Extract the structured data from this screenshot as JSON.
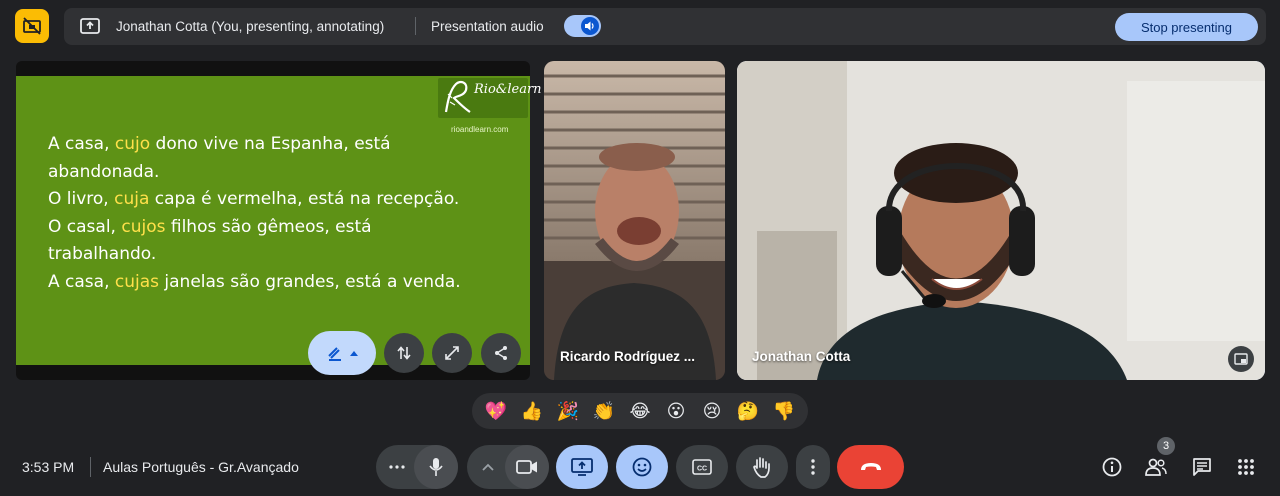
{
  "top_bar": {
    "presenter_label": "Jonathan Cotta (You, presenting, annotating)",
    "audio_label": "Presentation audio",
    "audio_on": true,
    "stop_button": "Stop presenting"
  },
  "slide": {
    "logo_name": "Rio&learn",
    "logo_url": "rioandlearn.com",
    "sentences": [
      {
        "before": "A casa, ",
        "highlight": "cujo",
        "after": " dono vive na Espanha, está abandonada."
      },
      {
        "before": "O livro, ",
        "highlight": "cuja",
        "after": " capa é vermelha, está na recepção."
      },
      {
        "before": "O casal, ",
        "highlight": "cujos",
        "after": " filhos são gêmeos, está trabalhando."
      },
      {
        "before": "A casa, ",
        "highlight": "cujas",
        "after": " janelas são grandes, está a venda."
      }
    ],
    "highlight_color": "#ffe04a",
    "background_color": "#5e9216"
  },
  "participants": [
    {
      "name": "Ricardo Rodríguez ..."
    },
    {
      "name": "Jonathan Cotta"
    }
  ],
  "reactions": [
    "💖",
    "👍",
    "🎉",
    "👏",
    "😂",
    "😮",
    "😢",
    "🤔",
    "👎"
  ],
  "bottom_bar": {
    "time": "3:53 PM",
    "meeting_name": "Aulas Português - Gr.Avançado",
    "participant_count": "3"
  },
  "colors": {
    "accent": "#a8c7fa",
    "end_call": "#ea4335",
    "hide_button": "#fbbc04"
  },
  "icons": [
    "hide-self-icon",
    "present-icon",
    "volume-icon",
    "pen-icon",
    "caret-up-icon",
    "swap-icon",
    "fullscreen-icon",
    "share-icon",
    "pip-icon",
    "more-icon",
    "mic-icon",
    "chevron-up-icon",
    "camera-icon",
    "present-screen-icon",
    "emoji-icon",
    "captions-icon",
    "raise-hand-icon",
    "more-vert-icon",
    "end-call-icon",
    "info-icon",
    "people-icon",
    "chat-icon",
    "apps-icon"
  ]
}
